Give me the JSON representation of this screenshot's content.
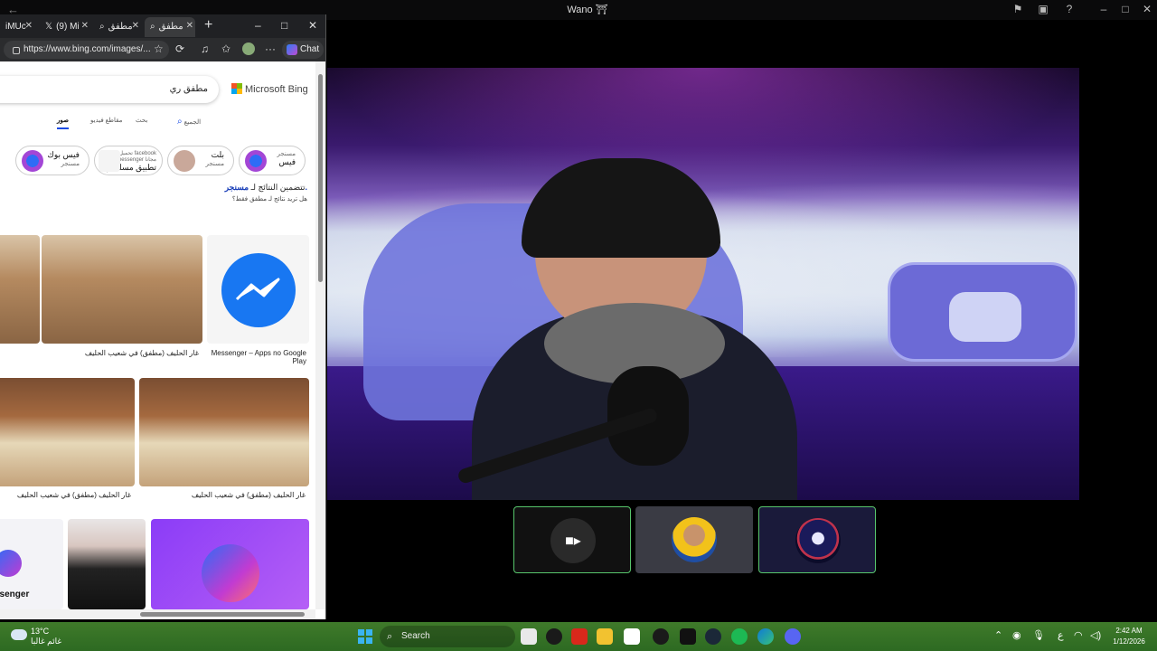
{
  "titlebar": {
    "title": "Wano ⛩"
  },
  "browser": {
    "tabs": [
      {
        "label": "iMUc"
      },
      {
        "label": "(9) Mi"
      },
      {
        "label": "مطفق"
      },
      {
        "label": "مطفق"
      }
    ],
    "url": "https://www.bing.com/images/...",
    "chat_label": "Chat"
  },
  "bing": {
    "brand": "Microsoft Bing",
    "query": "مطفق ري",
    "filters": [
      "الجميع",
      "بحث",
      "مقاطع فيديو",
      "صور"
    ],
    "chips": [
      {
        "title": "فيس",
        "sub": "مسنجر"
      },
      {
        "title": "بلت",
        "sub": "مسنجر"
      },
      {
        "title": "تطبيق مسلنجر",
        "sub": "تحميل facebook messenger مجانا"
      },
      {
        "title": "فيس بوك",
        "sub": "مسنجر"
      }
    ],
    "including_text": "تتضمين النتائج لـ",
    "including_term": "مسنجر.",
    "only_text": "هل تريد نتائج لـ مطفق فقط؟",
    "captions": {
      "messenger": "Messenger – Apps no Google Play",
      "desert": "غار الحليف (مطفق) في شعيب الحليف",
      "cave1": "غار الحليف (مطفق) في شعيب الحليف",
      "cave2": "غار الحليف (مطفق) في شعيب الحليف"
    },
    "partial_left_caption": "ssenger"
  },
  "taskbar": {
    "weather_temp": "13°C",
    "weather_desc": "غائم غالبا",
    "search_placeholder": "Search",
    "time": "2:42 AM",
    "date": "1/12/2026",
    "lang": "ع"
  },
  "colors": {
    "accent_active_tile": "#57c56b",
    "bing_blue": "#174ae4",
    "messenger_blue": "#1877f2"
  }
}
